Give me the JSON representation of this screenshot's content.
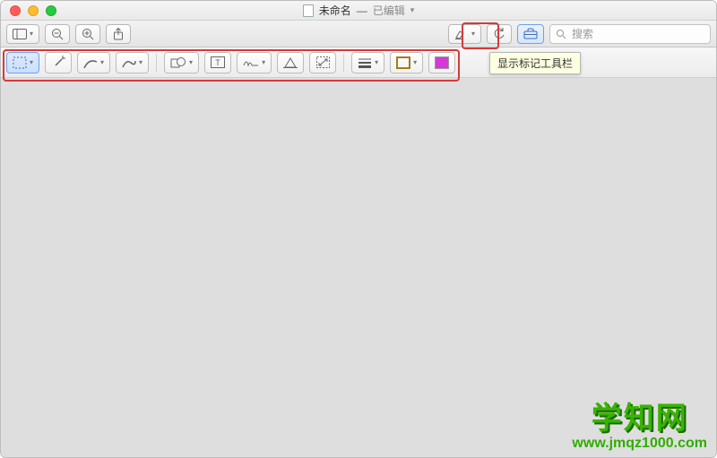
{
  "window": {
    "title": "未命名",
    "edited_label": "已编辑"
  },
  "toolbar": {
    "search_placeholder": "搜索"
  },
  "markup": {
    "tooltip": "显示标记工具栏",
    "colors": {
      "border_swatch": "#a47c1e",
      "fill_swatch": "#d63ad6"
    }
  },
  "watermark": {
    "title": "学知网",
    "url": "www.jmqz1000.com"
  },
  "highlight_color": "#d63a3a"
}
